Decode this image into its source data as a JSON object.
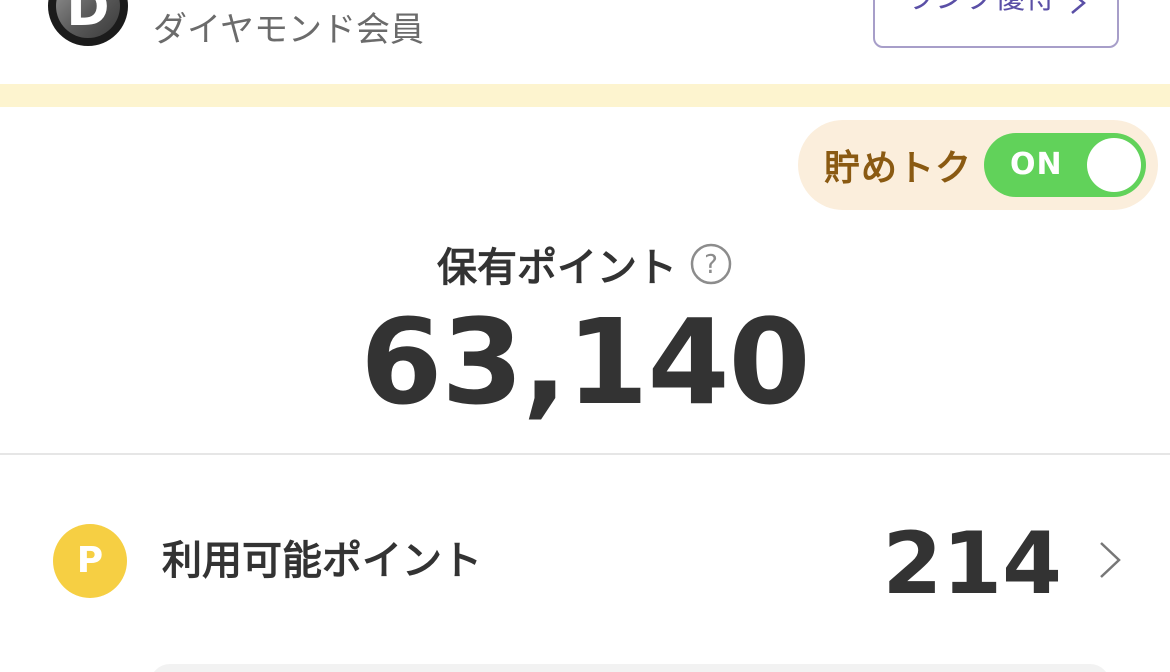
{
  "member": {
    "rank_letter": "D",
    "rank_name": "ダイヤモンド会員",
    "rank_benefit_label": "ランク優待"
  },
  "tametoku": {
    "label": "貯めトク",
    "toggle_state": "ON"
  },
  "held_points": {
    "title": "保有ポイント",
    "help_symbol": "?",
    "value": "63,140"
  },
  "available_points": {
    "coin_letter": "P",
    "label": "利用可能ポイント",
    "value": "214"
  },
  "colors": {
    "toggle_on": "#61d25a",
    "coin": "#f6cf43",
    "strip": "#fdf4cf",
    "pill": "#fbeedc",
    "benefit_border": "#a79ec9"
  }
}
